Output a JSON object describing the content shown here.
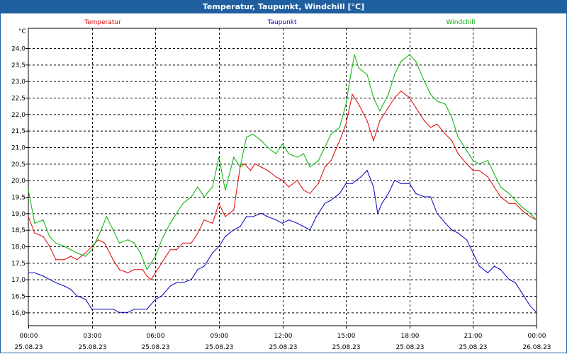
{
  "window": {
    "title": "Temperatur, Taupunkt, Windchill [°C]"
  },
  "chart_data": {
    "type": "line",
    "title": "Temperatur, Taupunkt, Windchill [°C]",
    "ylabel": "°C",
    "ylim": [
      15.6,
      24.6
    ],
    "yticks": [
      "16,0",
      "16,5",
      "17,0",
      "17,5",
      "18,0",
      "18,5",
      "19,0",
      "19,5",
      "20,0",
      "20,5",
      "21,0",
      "21,5",
      "22,0",
      "22,5",
      "23,0",
      "23,5",
      "24,0"
    ],
    "xlim": [
      0,
      24
    ],
    "xticks": [
      {
        "time": "00:00",
        "date": "25.08.23"
      },
      {
        "time": "03:00",
        "date": "25.08.23"
      },
      {
        "time": "06:00",
        "date": "25.08.23"
      },
      {
        "time": "09:00",
        "date": "25.08.23"
      },
      {
        "time": "12:00",
        "date": "25.08.23"
      },
      {
        "time": "15:00",
        "date": "25.08.23"
      },
      {
        "time": "18:00",
        "date": "25.08.23"
      },
      {
        "time": "21:00",
        "date": "25.08.23"
      },
      {
        "time": "00:00",
        "date": "26.08.23"
      }
    ],
    "grid": true,
    "legend_position": "top",
    "colors": {
      "Temperatur": "#e00000",
      "Taupunkt": "#0000c0",
      "Windchill": "#00b000"
    },
    "series": [
      {
        "name": "Temperatur",
        "color": "#e00000",
        "points": [
          [
            0,
            18.9
          ],
          [
            0.3,
            18.4
          ],
          [
            0.7,
            18.3
          ],
          [
            1,
            18
          ],
          [
            1.3,
            17.6
          ],
          [
            1.7,
            17.6
          ],
          [
            2,
            17.7
          ],
          [
            2.3,
            17.6
          ],
          [
            2.7,
            17.8
          ],
          [
            3,
            18
          ],
          [
            3.3,
            18.2
          ],
          [
            3.6,
            18.1
          ],
          [
            4,
            17.6
          ],
          [
            4.3,
            17.3
          ],
          [
            4.7,
            17.2
          ],
          [
            5,
            17.3
          ],
          [
            5.4,
            17.3
          ],
          [
            5.6,
            17.1
          ],
          [
            5.8,
            17
          ],
          [
            6,
            17.2
          ],
          [
            6.3,
            17.5
          ],
          [
            6.7,
            17.9
          ],
          [
            7,
            17.9
          ],
          [
            7.3,
            18.1
          ],
          [
            7.7,
            18.1
          ],
          [
            8,
            18.4
          ],
          [
            8.3,
            18.8
          ],
          [
            8.7,
            18.7
          ],
          [
            9,
            19.3
          ],
          [
            9.3,
            18.9
          ],
          [
            9.7,
            19.1
          ],
          [
            10,
            20.4
          ],
          [
            10.2,
            20.5
          ],
          [
            10.5,
            20.3
          ],
          [
            10.7,
            20.5
          ],
          [
            11,
            20.4
          ],
          [
            11.3,
            20.3
          ],
          [
            11.7,
            20.1
          ],
          [
            12,
            20
          ],
          [
            12.3,
            19.8
          ],
          [
            12.7,
            20
          ],
          [
            13,
            19.7
          ],
          [
            13.3,
            19.6
          ],
          [
            13.7,
            19.9
          ],
          [
            14,
            20.4
          ],
          [
            14.3,
            20.6
          ],
          [
            14.7,
            21.2
          ],
          [
            15,
            21.7
          ],
          [
            15.3,
            22.6
          ],
          [
            15.6,
            22.3
          ],
          [
            16,
            21.8
          ],
          [
            16.3,
            21.2
          ],
          [
            16.6,
            21.8
          ],
          [
            17,
            22.2
          ],
          [
            17.3,
            22.5
          ],
          [
            17.6,
            22.7
          ],
          [
            18,
            22.5
          ],
          [
            18.3,
            22.2
          ],
          [
            18.7,
            21.8
          ],
          [
            19,
            21.6
          ],
          [
            19.3,
            21.7
          ],
          [
            19.7,
            21.4
          ],
          [
            20,
            21.2
          ],
          [
            20.3,
            20.8
          ],
          [
            20.7,
            20.5
          ],
          [
            21,
            20.3
          ],
          [
            21.3,
            20.3
          ],
          [
            21.7,
            20.1
          ],
          [
            22,
            19.8
          ],
          [
            22.3,
            19.5
          ],
          [
            22.7,
            19.3
          ],
          [
            23,
            19.3
          ],
          [
            23.3,
            19.1
          ],
          [
            23.7,
            18.9
          ],
          [
            24,
            18.8
          ]
        ]
      },
      {
        "name": "Taupunkt",
        "color": "#0000c0",
        "points": [
          [
            0,
            17.2
          ],
          [
            0.3,
            17.2
          ],
          [
            0.7,
            17.1
          ],
          [
            1,
            17
          ],
          [
            1.3,
            16.9
          ],
          [
            1.7,
            16.8
          ],
          [
            2,
            16.7
          ],
          [
            2.3,
            16.5
          ],
          [
            2.7,
            16.4
          ],
          [
            3,
            16.1
          ],
          [
            3.3,
            16.1
          ],
          [
            3.7,
            16.1
          ],
          [
            4,
            16.1
          ],
          [
            4.3,
            16
          ],
          [
            4.7,
            16
          ],
          [
            5,
            16.1
          ],
          [
            5.3,
            16.1
          ],
          [
            5.6,
            16.1
          ],
          [
            6,
            16.4
          ],
          [
            6.3,
            16.5
          ],
          [
            6.7,
            16.8
          ],
          [
            7,
            16.9
          ],
          [
            7.3,
            16.9
          ],
          [
            7.7,
            17
          ],
          [
            8,
            17.3
          ],
          [
            8.3,
            17.4
          ],
          [
            8.7,
            17.8
          ],
          [
            9,
            18
          ],
          [
            9.3,
            18.3
          ],
          [
            9.7,
            18.5
          ],
          [
            10,
            18.6
          ],
          [
            10.3,
            18.9
          ],
          [
            10.6,
            18.9
          ],
          [
            11,
            19
          ],
          [
            11.3,
            18.9
          ],
          [
            11.7,
            18.8
          ],
          [
            12,
            18.7
          ],
          [
            12.3,
            18.8
          ],
          [
            12.7,
            18.7
          ],
          [
            13,
            18.6
          ],
          [
            13.3,
            18.5
          ],
          [
            13.6,
            18.9
          ],
          [
            14,
            19.3
          ],
          [
            14.3,
            19.4
          ],
          [
            14.7,
            19.6
          ],
          [
            15,
            19.9
          ],
          [
            15.3,
            19.9
          ],
          [
            15.7,
            20.1
          ],
          [
            16,
            20.3
          ],
          [
            16.3,
            19.8
          ],
          [
            16.5,
            19
          ],
          [
            16.7,
            19.3
          ],
          [
            17,
            19.6
          ],
          [
            17.3,
            20
          ],
          [
            17.6,
            19.9
          ],
          [
            18,
            19.9
          ],
          [
            18.3,
            19.6
          ],
          [
            18.7,
            19.5
          ],
          [
            19,
            19.5
          ],
          [
            19.3,
            19
          ],
          [
            19.7,
            18.7
          ],
          [
            20,
            18.5
          ],
          [
            20.3,
            18.4
          ],
          [
            20.7,
            18.2
          ],
          [
            21,
            17.8
          ],
          [
            21.3,
            17.4
          ],
          [
            21.7,
            17.2
          ],
          [
            22,
            17.4
          ],
          [
            22.3,
            17.3
          ],
          [
            22.7,
            17
          ],
          [
            23,
            16.9
          ],
          [
            23.3,
            16.6
          ],
          [
            23.7,
            16.2
          ],
          [
            24,
            16
          ]
        ]
      },
      {
        "name": "Windchill",
        "color": "#00b000",
        "points": [
          [
            0,
            19.7
          ],
          [
            0.3,
            18.7
          ],
          [
            0.7,
            18.8
          ],
          [
            1,
            18.3
          ],
          [
            1.3,
            18.1
          ],
          [
            1.7,
            18
          ],
          [
            2,
            17.9
          ],
          [
            2.3,
            17.8
          ],
          [
            2.7,
            17.7
          ],
          [
            3,
            17.9
          ],
          [
            3.3,
            18.3
          ],
          [
            3.7,
            18.9
          ],
          [
            4,
            18.5
          ],
          [
            4.3,
            18.1
          ],
          [
            4.7,
            18.2
          ],
          [
            5,
            18.1
          ],
          [
            5.3,
            17.8
          ],
          [
            5.6,
            17.3
          ],
          [
            6,
            17.7
          ],
          [
            6.3,
            18.2
          ],
          [
            6.7,
            18.7
          ],
          [
            7,
            19
          ],
          [
            7.3,
            19.3
          ],
          [
            7.7,
            19.5
          ],
          [
            8,
            19.8
          ],
          [
            8.3,
            19.5
          ],
          [
            8.7,
            19.8
          ],
          [
            9,
            20.7
          ],
          [
            9.3,
            19.7
          ],
          [
            9.7,
            20.7
          ],
          [
            10,
            20.4
          ],
          [
            10.3,
            21.3
          ],
          [
            10.6,
            21.4
          ],
          [
            11,
            21.2
          ],
          [
            11.3,
            21
          ],
          [
            11.7,
            20.8
          ],
          [
            12,
            21.1
          ],
          [
            12.3,
            20.8
          ],
          [
            12.7,
            20.7
          ],
          [
            13,
            20.8
          ],
          [
            13.3,
            20.4
          ],
          [
            13.7,
            20.6
          ],
          [
            14,
            21
          ],
          [
            14.3,
            21.4
          ],
          [
            14.7,
            21.6
          ],
          [
            15,
            22.3
          ],
          [
            15.2,
            23.1
          ],
          [
            15.4,
            23.8
          ],
          [
            15.6,
            23.4
          ],
          [
            16,
            23.2
          ],
          [
            16.3,
            22.5
          ],
          [
            16.6,
            22.1
          ],
          [
            17,
            22.6
          ],
          [
            17.3,
            23.2
          ],
          [
            17.6,
            23.6
          ],
          [
            18,
            23.8
          ],
          [
            18.3,
            23.6
          ],
          [
            18.7,
            23
          ],
          [
            19,
            22.6
          ],
          [
            19.3,
            22.4
          ],
          [
            19.7,
            22.3
          ],
          [
            20,
            21.9
          ],
          [
            20.3,
            21.3
          ],
          [
            20.7,
            20.9
          ],
          [
            21,
            20.6
          ],
          [
            21.3,
            20.5
          ],
          [
            21.7,
            20.6
          ],
          [
            22,
            20.2
          ],
          [
            22.3,
            19.8
          ],
          [
            22.7,
            19.6
          ],
          [
            23,
            19.4
          ],
          [
            23.3,
            19.2
          ],
          [
            23.7,
            19
          ],
          [
            24,
            18.8
          ]
        ]
      }
    ]
  }
}
